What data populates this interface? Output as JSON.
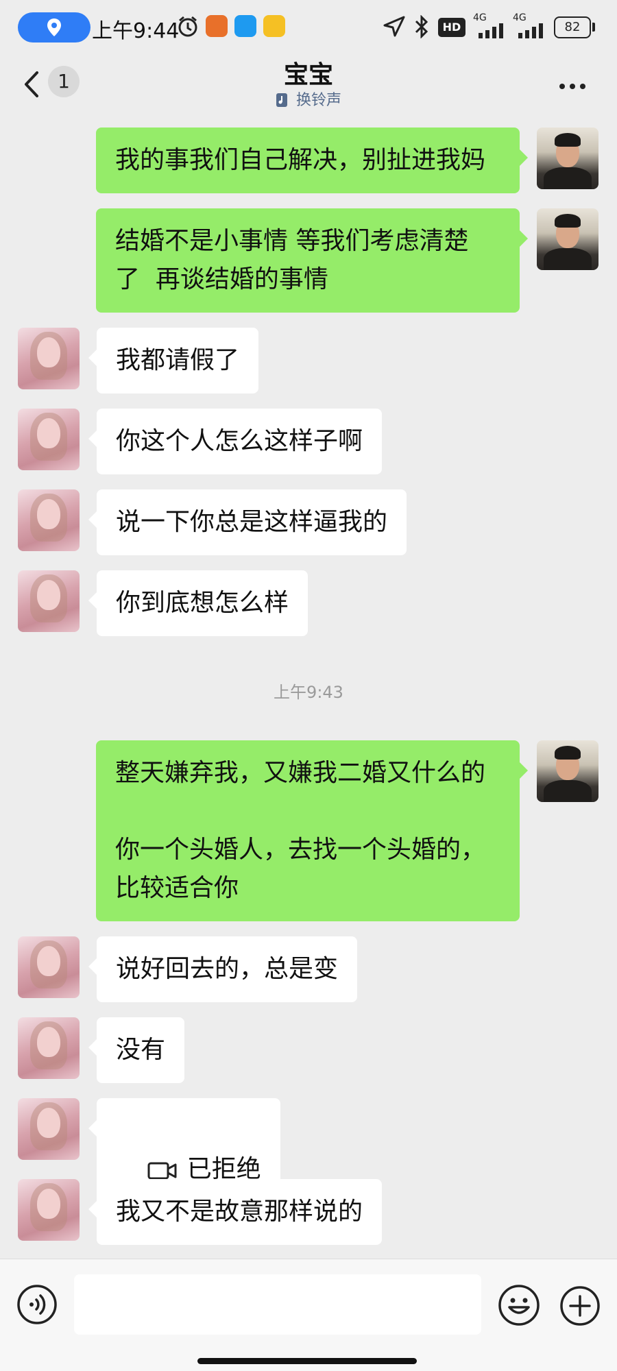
{
  "status_bar": {
    "time": "上午9:44",
    "battery": "82",
    "hd_label": "HD",
    "network_1": "4G",
    "network_2": "4G",
    "icons": [
      "location-icon",
      "alarm-icon",
      "app-tiger-icon",
      "app-blue-icon",
      "app-yellow-icon",
      "navigation-icon",
      "bluetooth-icon"
    ]
  },
  "header": {
    "back_count": "1",
    "title": "宝宝",
    "subtitle": "换铃声"
  },
  "messages": [
    {
      "side": "out",
      "text": "我的事我们自己解决，别扯进我妈"
    },
    {
      "side": "out",
      "text": "结婚不是小事情 等我们考虑清楚\n了  再谈结婚的事情"
    },
    {
      "side": "in",
      "text": "我都请假了"
    },
    {
      "side": "in",
      "text": "你这个人怎么这样子啊"
    },
    {
      "side": "in",
      "text": "说一下你总是这样逼我的"
    },
    {
      "side": "in",
      "text": "你到底想怎么样"
    },
    {
      "side": "out",
      "text": "整天嫌弃我，又嫌我二婚又什么的\n\n你一个头婚人，去找一个头婚的，\n比较适合你"
    },
    {
      "side": "in",
      "text": "说好回去的，总是变"
    },
    {
      "side": "in",
      "text": "没有"
    },
    {
      "side": "in",
      "text": "已拒绝",
      "icon": "video-call-icon"
    },
    {
      "side": "in",
      "text": "我又不是故意那样说的"
    }
  ],
  "timestamp": "上午9:43",
  "input": {
    "value": "",
    "placeholder": ""
  },
  "colors": {
    "background": "#ededed",
    "outgoing_bubble": "#95ec69",
    "incoming_bubble": "#ffffff",
    "accent": "#2f7df6"
  }
}
